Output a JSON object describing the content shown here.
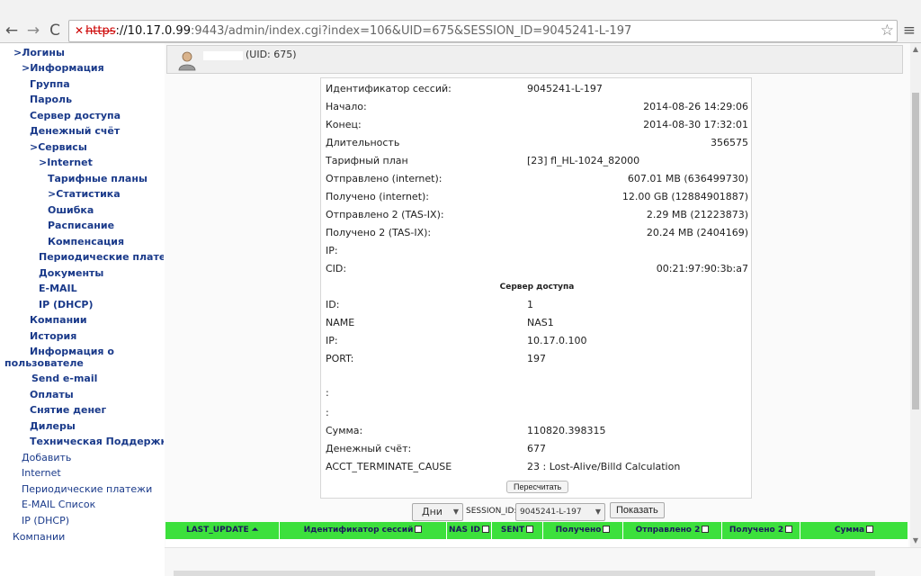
{
  "browser": {
    "url_protocol": "https",
    "url_host": "://10.17.0.99",
    "url_path": ":9443/admin/index.cgi?index=106&UID=675&SESSION_ID=9045241-L-197",
    "back_glyph": "←",
    "forward_glyph": "→",
    "reload_glyph": "C",
    "star_glyph": "☆",
    "menu_glyph": "≡",
    "lock_glyph": "✕"
  },
  "nav": {
    "items": [
      {
        "label": ">Логины",
        "bold": true
      },
      {
        "label": ">Информация",
        "bold": true
      },
      {
        "label": "Группа",
        "bold": true
      },
      {
        "label": "Пароль",
        "bold": true
      },
      {
        "label": "Сервер доступа",
        "bold": true
      },
      {
        "label": "Денежный счёт",
        "bold": true
      },
      {
        "label": ">Сервисы",
        "bold": true
      },
      {
        "label": ">Internet",
        "bold": true
      },
      {
        "label": "Тарифные планы",
        "bold": true
      },
      {
        "label": ">Статистика",
        "bold": true
      },
      {
        "label": "Ошибка",
        "bold": true
      },
      {
        "label": "Расписание",
        "bold": true
      },
      {
        "label": "Компенсация",
        "bold": true
      },
      {
        "label": "Периодические платежи",
        "bold": true
      },
      {
        "label": "Документы",
        "bold": true
      },
      {
        "label": "E-MAIL",
        "bold": true
      },
      {
        "label": "IP (DHCP)",
        "bold": true
      },
      {
        "label": "Компании",
        "bold": true
      },
      {
        "label": "История",
        "bold": true
      },
      {
        "label": "Информация о",
        "bold": true
      },
      {
        "label": "пользователе",
        "bold": true
      },
      {
        "label": "Send e-mail",
        "bold": true
      },
      {
        "label": "Оплаты",
        "bold": true
      },
      {
        "label": "Снятие денег",
        "bold": true
      },
      {
        "label": "Дилеры",
        "bold": true
      },
      {
        "label": "Техническая Поддержка",
        "bold": true
      },
      {
        "label": "Добавить",
        "bold": false
      },
      {
        "label": "Internet",
        "bold": false
      },
      {
        "label": "Периодические платежи",
        "bold": false
      },
      {
        "label": "E-MAIL Список",
        "bold": false
      },
      {
        "label": "IP (DHCP)",
        "bold": false
      },
      {
        "label": "Компании",
        "bold": false
      }
    ]
  },
  "user": {
    "uid_text": "(UID: 675)"
  },
  "session": {
    "rows": [
      {
        "label": "Идентификатор сессий:",
        "value": "9045241-L-197",
        "align": "left"
      },
      {
        "label": "Начало:",
        "value": "2014-08-26 14:29:06",
        "align": "right"
      },
      {
        "label": "Конец:",
        "value": "2014-08-30 17:32:01",
        "align": "right"
      },
      {
        "label": "Длительность",
        "value": "356575",
        "align": "right"
      },
      {
        "label": "Тарифный план",
        "value": "[23] fl_HL-1024_82000",
        "align": "left"
      },
      {
        "label": "Отправлено (internet):",
        "value": "607.01 MB (636499730)",
        "align": "right"
      },
      {
        "label": "Получено (internet):",
        "value": "12.00 GB (12884901887)",
        "align": "right"
      },
      {
        "label": "Отправлено 2 (TAS-IX):",
        "value": "2.29 MB (21223873)",
        "align": "right"
      },
      {
        "label": "Получено 2 (TAS-IX):",
        "value": "20.24 MB (2404169)",
        "align": "right"
      },
      {
        "label": "IP:",
        "value": "",
        "align": "left"
      },
      {
        "label": "CID:",
        "value": "00:21:97:90:3b:a7",
        "align": "right"
      }
    ],
    "nas_section_title": "Сервер доступа",
    "nas_rows": [
      {
        "label": "ID:",
        "value": "1"
      },
      {
        "label": "NAME",
        "value": "NAS1"
      },
      {
        "label": "IP:",
        "value": "10.17.0.100"
      },
      {
        "label": "PORT:",
        "value": "197"
      }
    ],
    "extra_rows": [
      {
        "label": ":",
        "value": ""
      },
      {
        "label": ":",
        "value": ""
      },
      {
        "label": "Сумма:",
        "value": "110820.398315"
      },
      {
        "label": "Денежный счёт:",
        "value": "677"
      },
      {
        "label": "ACCT_TERMINATE_CAUSE",
        "value": "23 : Lost-Alive/Billd Calculation"
      }
    ],
    "recalc_label": "Пересчитать"
  },
  "filters": {
    "period_value": "Дни",
    "session_id_label": "SESSION_ID:",
    "session_id_value": "9045241-L-197",
    "show_label": "Показать"
  },
  "table": {
    "columns": [
      {
        "label": "LAST_UPDATE",
        "icon": "sort-up-icon"
      },
      {
        "label": "Идентификатор сессий",
        "icon": "checkbox-icon"
      },
      {
        "label": "NAS ID",
        "icon": "checkbox-icon"
      },
      {
        "label": "SENT",
        "icon": "checkbox-icon"
      },
      {
        "label": "Получено",
        "icon": "checkbox-icon"
      },
      {
        "label": "Отправлено 2",
        "icon": "checkbox-icon"
      },
      {
        "label": "Получено 2",
        "icon": "checkbox-icon"
      },
      {
        "label": "Сумма",
        "icon": "checkbox-icon"
      }
    ]
  },
  "colors": {
    "table_header": "#3ce03c",
    "nav_link": "#1a3a8a",
    "url_insecure": "#cc0000"
  }
}
